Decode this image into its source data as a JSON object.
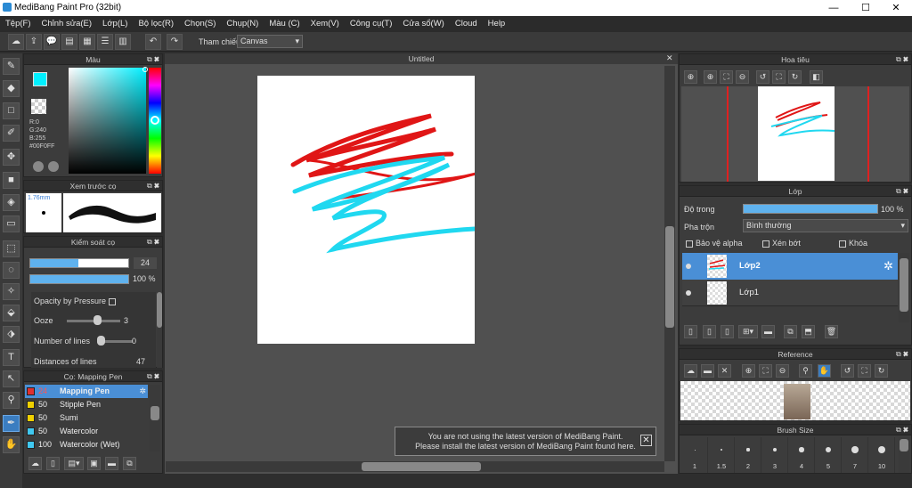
{
  "window": {
    "title": "MediBang Paint Pro (32bit)",
    "minimize": "—",
    "maximize": "☐",
    "close": "✕"
  },
  "menu": [
    "Tệp(F)",
    "Chỉnh sửa(E)",
    "Lớp(L)",
    "Bộ lọc(R)",
    "Chọn(S)",
    "Chụp(N)",
    "Màu (C)",
    "Xem(V)",
    "Công cụ(T)",
    "Cửa sổ(W)",
    "Cloud",
    "Help"
  ],
  "toolbar": {
    "ref_label": "Tham chiếu",
    "ref_value": "Canvas"
  },
  "color_panel": {
    "title": "Màu",
    "r": "R:0",
    "g": "G:240",
    "b": "B:255",
    "hex": "#00F0FF",
    "fg": "#00F0FF"
  },
  "brush_preview": {
    "title": "Xem trước cọ",
    "size": "1.76mm"
  },
  "brush_control": {
    "title": "Kiểm soát cọ",
    "size_value": "24",
    "size_frac": 0.49,
    "opacity_value": "100 %",
    "opacity_frac": 1.0,
    "opacity_by_pressure": "Opacity by Pressure",
    "ooze_label": "Ooze",
    "ooze_value": "3",
    "lines_label": "Number of lines",
    "lines_value": "0",
    "dist_label": "Distances of lines",
    "dist_value": "47"
  },
  "brush_list": {
    "title": "Cọ: Mapping Pen",
    "items": [
      {
        "size": "24",
        "name": "Mapping Pen",
        "color": "#e03030",
        "selected": true
      },
      {
        "size": "50",
        "name": "Stipple Pen",
        "color": "#f0d000",
        "selected": false
      },
      {
        "size": "50",
        "name": "Sumi",
        "color": "#f0d000",
        "selected": false
      },
      {
        "size": "50",
        "name": "Watercolor",
        "color": "#40c8f0",
        "selected": false
      },
      {
        "size": "100",
        "name": "Watercolor (Wet)",
        "color": "#40c8f0",
        "selected": false
      }
    ]
  },
  "document": {
    "tab": "Untitled"
  },
  "notice": {
    "line1": "You are not using the latest version of MediBang Paint.",
    "line2": "Please install the latest version of MediBang Paint found here."
  },
  "navigator": {
    "title": "Hoa tiêu"
  },
  "layers": {
    "title": "Lớp",
    "opacity_label": "Độ trong",
    "opacity_value": "100 %",
    "blend_label": "Pha trộn",
    "blend_value": "Bình thường",
    "protect_alpha": "Bảo vệ alpha",
    "clipping": "Xén bớt",
    "lock": "Khóa",
    "items": [
      {
        "name": "Lớp2",
        "selected": true
      },
      {
        "name": "Lớp1",
        "selected": false
      }
    ]
  },
  "reference": {
    "title": "Reference"
  },
  "brush_size": {
    "title": "Brush Size",
    "sizes": [
      "1",
      "1.5",
      "2",
      "3",
      "4",
      "5",
      "7",
      "10"
    ]
  }
}
